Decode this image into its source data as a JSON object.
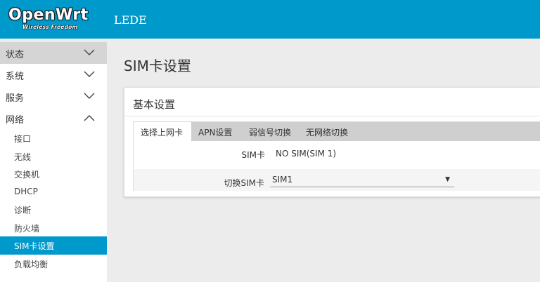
{
  "header": {
    "logo_main": "OpenWrt",
    "logo_sub": "Wireless Freedom",
    "brand": "LEDE",
    "bar_color": "#0099cc"
  },
  "sidebar": {
    "items": [
      {
        "label": "状态",
        "expanded": false,
        "icon": "chevron-down-icon"
      },
      {
        "label": "系统",
        "expanded": false,
        "icon": "chevron-down-icon"
      },
      {
        "label": "服务",
        "expanded": false,
        "icon": "chevron-down-icon"
      },
      {
        "label": "网络",
        "expanded": true,
        "icon": "chevron-up-icon"
      }
    ],
    "network_subitems": [
      "接口",
      "无线",
      "交换机",
      "DHCP",
      "诊断",
      "防火墙",
      "SIM卡设置",
      "负载均衡"
    ],
    "active_subitem": "SIM卡设置",
    "active_color": "#0099cc"
  },
  "main": {
    "page_title": "SIM卡设置",
    "section_title": "基本设置",
    "tabs": [
      "选择上网卡",
      "APN设置",
      "弱信号切换",
      "无网络切换"
    ],
    "active_tab": "选择上网卡",
    "fields": {
      "sim_card_label": "SIM卡",
      "sim_card_value": "NO SIM(SIM 1)",
      "switch_label": "切换SIM卡",
      "switch_value": "SIM1",
      "select_arrow": "▼"
    }
  }
}
